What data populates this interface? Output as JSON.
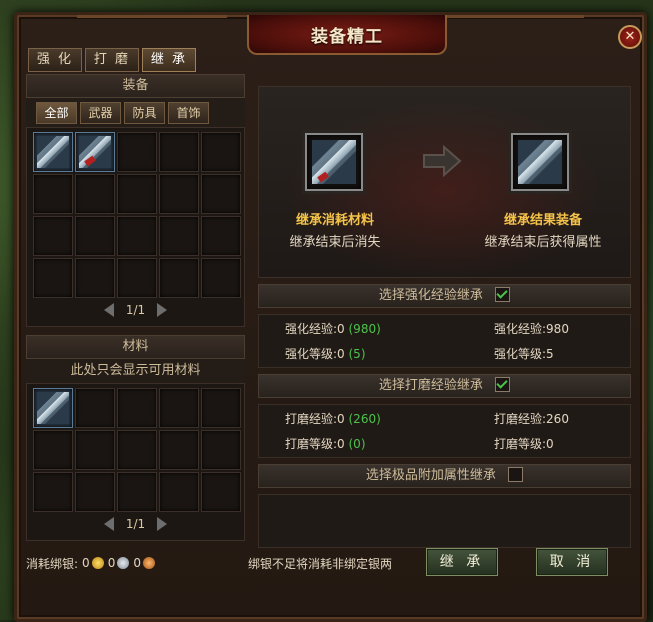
{
  "window": {
    "title": "装备精工",
    "close_symbol": "✕"
  },
  "tabs": [
    {
      "label": "强 化",
      "active": false
    },
    {
      "label": "打 磨",
      "active": false
    },
    {
      "label": "继 承",
      "active": true
    }
  ],
  "equipment": {
    "header": "装备",
    "filters": [
      {
        "label": "全部",
        "active": true
      },
      {
        "label": "武器",
        "active": false
      },
      {
        "label": "防具",
        "active": false
      },
      {
        "label": "首饰",
        "active": false
      }
    ],
    "items": [
      {
        "icon": "sword-icon",
        "variant": "plain"
      },
      {
        "icon": "sword-icon",
        "variant": "red"
      }
    ],
    "slot_count": 20,
    "pager": "1/1"
  },
  "materials": {
    "header": "材料",
    "note": "此处只会显示可用材料",
    "items": [
      {
        "icon": "sword-icon",
        "variant": "plain"
      }
    ],
    "slot_count": 15,
    "pager": "1/1"
  },
  "preview": {
    "source_title": "继承消耗材料",
    "source_sub": "继承结束后消失",
    "target_title": "继承结果装备",
    "target_sub": "继承结束后获得属性"
  },
  "options": [
    {
      "label": "选择强化经验继承",
      "checked": true,
      "stats": [
        {
          "left_prefix": "强化经验:0 ",
          "left_gain": "(980)",
          "right": "强化经验:980"
        },
        {
          "left_prefix": "强化等级:0 ",
          "left_gain": "(5)",
          "right": "强化等级:5"
        }
      ]
    },
    {
      "label": "选择打磨经验继承",
      "checked": true,
      "stats": [
        {
          "left_prefix": "打磨经验:0 ",
          "left_gain": "(260)",
          "right": "打磨经验:260"
        },
        {
          "left_prefix": "打磨等级:0 ",
          "left_gain": "(0)",
          "right": "打磨等级:0"
        }
      ]
    },
    {
      "label": "选择极品附加属性继承",
      "checked": false,
      "stats": []
    }
  ],
  "footer": {
    "cost_label": "消耗绑银:",
    "coin1": "0",
    "coin2": "0",
    "coin3": "0",
    "warning": "绑银不足将消耗非绑定银两",
    "inherit_button": "继 承",
    "cancel_button": "取 消"
  },
  "colors": {
    "accent_gold": "#f4c34a",
    "gain_green": "#4cc24a",
    "title_red": "#7a1c14"
  }
}
